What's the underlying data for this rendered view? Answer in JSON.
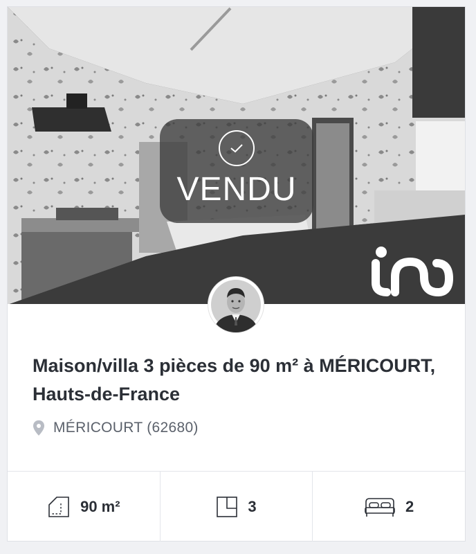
{
  "listing": {
    "status": "VENDU",
    "title": "Maison/villa 3 pièces de 90 m² à MÉRICOURT, Hauts-de-France",
    "location": "MÉRICOURT (62680)",
    "photo_icon": "kitchen-photo",
    "agent_icon": "agent-avatar"
  },
  "stats": {
    "area": {
      "icon": "floor-plan-area-icon",
      "value": "90 m²"
    },
    "rooms": {
      "icon": "rooms-plan-icon",
      "value": "3"
    },
    "bedrooms": {
      "icon": "double-bed-icon",
      "value": "2"
    }
  },
  "colors": {
    "text_dark": "#2b2f36",
    "text_muted": "#5b616b",
    "badge_bg": "#3c3c3c",
    "page_bg": "#f0f1f4"
  }
}
